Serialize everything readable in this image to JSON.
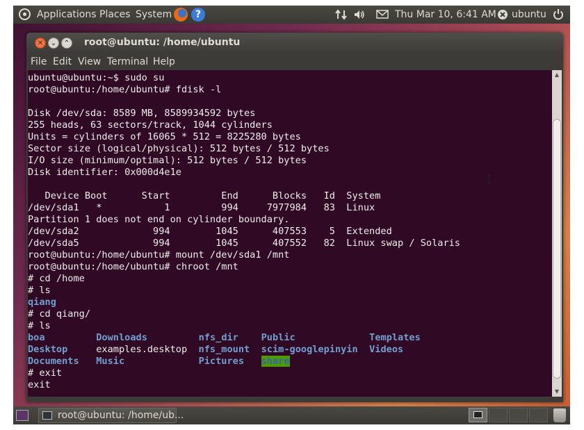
{
  "top_panel": {
    "applications": "Applications",
    "places": "Places",
    "system": "System",
    "datetime": "Thu Mar 10,  6:41 AM",
    "user": "ubuntu"
  },
  "window": {
    "title": "root@ubuntu: /home/ubuntu",
    "menu": [
      "File",
      "Edit",
      "View",
      "Terminal",
      "Help"
    ]
  },
  "terminal": {
    "lines_before": [
      "ubuntu@ubuntu:~$ sudo su",
      "root@ubuntu:/home/ubuntu# fdisk -l",
      "",
      "Disk /dev/sda: 8589 MB, 8589934592 bytes",
      "255 heads, 63 sectors/track, 1044 cylinders",
      "Units = cylinders of 16065 * 512 = 8225280 bytes",
      "Sector size (logical/physical): 512 bytes / 512 bytes",
      "I/O size (minimum/optimal): 512 bytes / 512 bytes",
      "Disk identifier: 0x000d4e1e",
      "",
      "   Device Boot      Start         End      Blocks   Id  System",
      "/dev/sda1   *           1         994     7977984   83  Linux",
      "Partition 1 does not end on cylinder boundary.",
      "/dev/sda2             994        1045      407553    5  Extended",
      "/dev/sda5             994        1045      407552   82  Linux swap / Solaris",
      "root@ubuntu:/home/ubuntu# mount /dev/sda1 /mnt",
      "root@ubuntu:/home/ubuntu# chroot /mnt",
      "# cd /home",
      "# ls"
    ],
    "ls_home": "qiang",
    "lines_mid": [
      "# cd qiang/",
      "# ls"
    ],
    "ls_row1": [
      "boa",
      "Downloads",
      "nfs_dir",
      "Public",
      "Templates"
    ],
    "ls_row2": [
      "Desktop",
      "examples.desktop",
      "nfs_mount",
      "scim-googlepinyin",
      "Videos"
    ],
    "ls_row3": [
      "Documents",
      "Music",
      "Pictures",
      "share"
    ],
    "lines_after": [
      "# exit",
      "exit"
    ]
  },
  "bottom_panel": {
    "task_label": "root@ubuntu: /home/ub..."
  },
  "icons": {
    "ubuntu_logo": "ubuntu-logo-icon",
    "firefox": "firefox-icon",
    "help": "help-icon",
    "network": "network-icon",
    "volume": "volume-icon",
    "mail": "mail-icon",
    "user": "user-icon",
    "power": "power-icon",
    "terminal": "terminal-icon",
    "trash": "trash-icon"
  },
  "colors": {
    "terminal_bg": "#300a24",
    "terminal_fg": "#eeeeec",
    "dir_blue": "#729fcf",
    "highlight_green": "#4e9a06"
  }
}
